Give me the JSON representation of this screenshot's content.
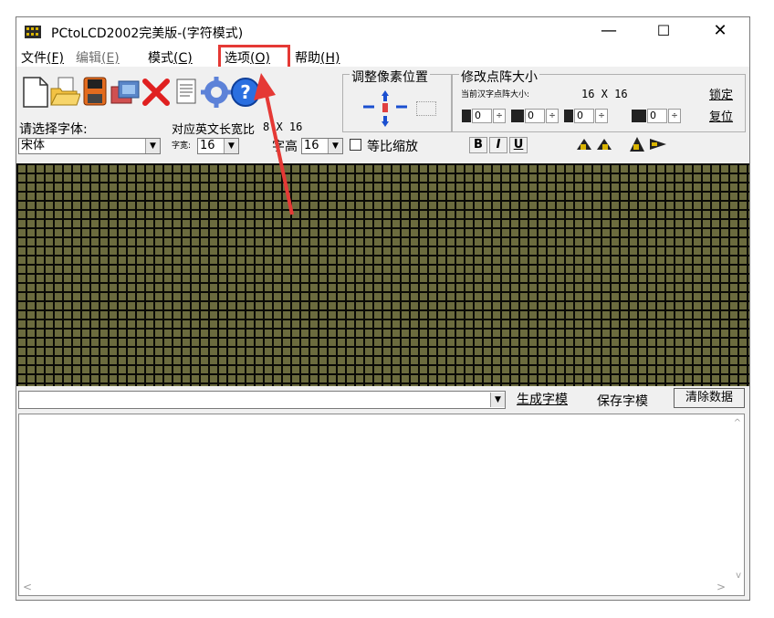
{
  "window": {
    "title": "PCtoLCD2002完美版-(字符模式)",
    "minimize_glyph": "—",
    "maximize_glyph": "☐",
    "close_glyph": "✕"
  },
  "menu": [
    {
      "label": "文件",
      "key": "(F)",
      "enabled": true
    },
    {
      "label": "编辑",
      "key": "(E)",
      "enabled": false
    },
    {
      "label": "模式",
      "key": "(C)",
      "enabled": true
    },
    {
      "label": "选项",
      "key": "(O)",
      "enabled": true
    },
    {
      "label": "帮助",
      "key": "(H)",
      "enabled": true
    }
  ],
  "toolbar": {
    "icons": [
      "new-file-icon",
      "open-folder-icon",
      "save-icon",
      "import-image-icon",
      "delete-icon",
      "document-icon",
      "settings-gear-icon",
      "help-icon"
    ],
    "choose_font_label": "请选择字体:",
    "font_value": "宋体",
    "english_width_label": "对应英文长宽比",
    "english_size": "8 X 16",
    "char_width_label": "字宽:",
    "char_width_value": "16",
    "char_height_label": "字高",
    "char_height_value": "16",
    "proportional_label": "等比缩放",
    "adjust_position_label": "调整像素位置",
    "modify_matrix_label": "修改点阵大小",
    "current_size_label": "当前汉字点阵大小:",
    "current_size_value": "16 X 16",
    "lock_label": "锁定",
    "reset_label": "复位",
    "spin_values": [
      "0",
      "0",
      "0",
      "0"
    ],
    "bold_label": "B",
    "italic_label": "I",
    "underline_label": "U"
  },
  "bottom": {
    "generate_label": "生成字模",
    "save_label": "保存字模",
    "clear_label": "清除数据"
  },
  "colors": {
    "grid_cell": "#6b6b3e",
    "grid_line": "#0a0a06",
    "highlight": "#e53935"
  }
}
